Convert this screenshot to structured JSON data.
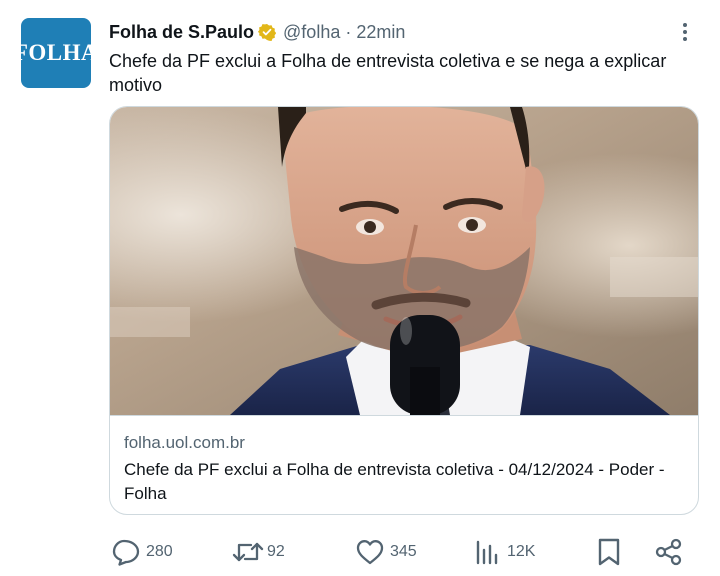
{
  "account": {
    "avatar_text": "FOLHA",
    "name": "Folha de S.Paulo",
    "handle": "@folha",
    "separator": "·",
    "time": "22min"
  },
  "tweet": {
    "text": "Chefe da PF exclui a Folha de entrevista coletiva e se nega a explicar motivo"
  },
  "card": {
    "domain": "folha.uol.com.br",
    "title": "Chefe da PF exclui a Folha de entrevista coletiva - 04/12/2024 - Poder - Folha"
  },
  "actions": {
    "replies": "280",
    "reposts": "92",
    "likes": "345",
    "views": "12K"
  },
  "colors": {
    "verified_badge": "#e2b719",
    "avatar_bg": "#1f7fb6",
    "secondary_text": "#536471"
  }
}
